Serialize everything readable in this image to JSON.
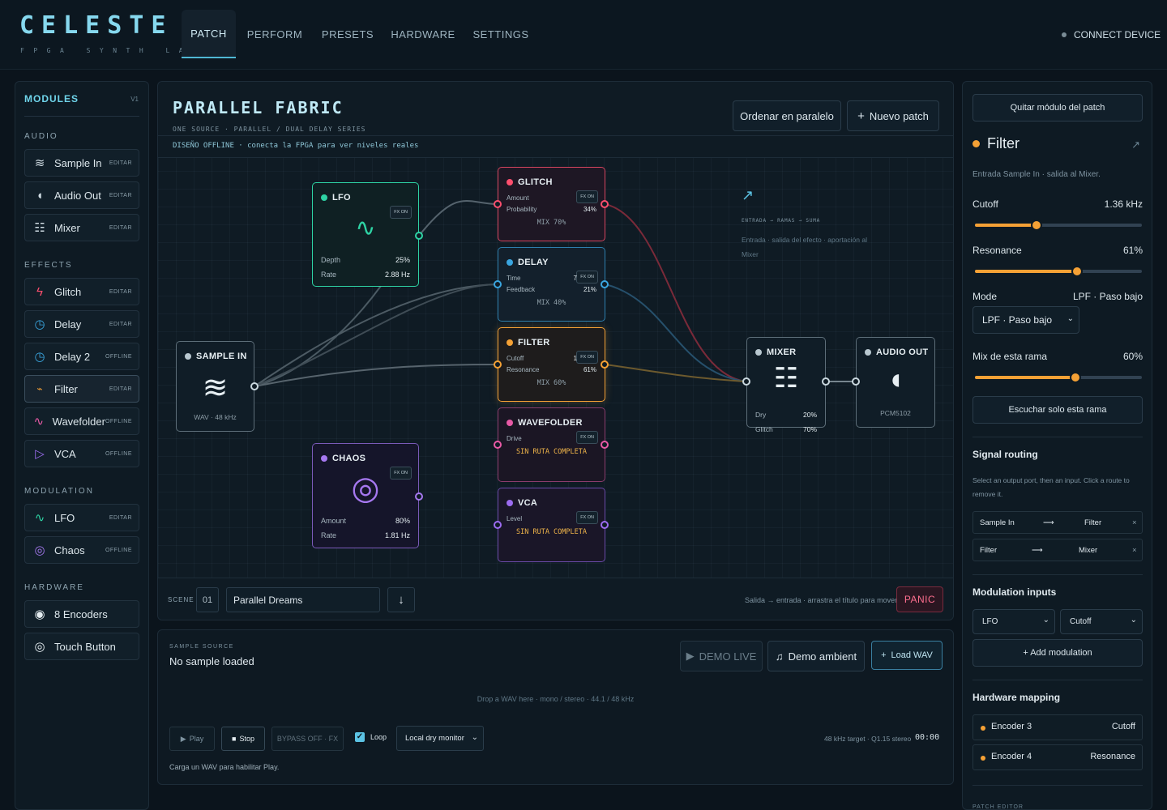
{
  "brand": {
    "title": "CELESTE",
    "subtitle": "FPGA SYNTH LAB"
  },
  "nav": {
    "tabs": [
      "PATCH",
      "PERFORM",
      "PRESETS",
      "HARDWARE",
      "SETTINGS"
    ],
    "active": "PATCH"
  },
  "connect_label": "CONNECT DEVICE",
  "sidebar": {
    "title": "MODULES",
    "version": "V1",
    "sections": [
      {
        "title": "AUDIO",
        "items": [
          {
            "label": "Sample In",
            "badge": "EDITAR",
            "icon": "waves-icon"
          },
          {
            "label": "Audio Out",
            "badge": "EDITAR",
            "icon": "half-moon-icon"
          },
          {
            "label": "Mixer",
            "badge": "EDITAR",
            "icon": "mixer-icon"
          }
        ]
      },
      {
        "title": "EFFECTS",
        "items": [
          {
            "label": "Glitch",
            "badge": "EDITAR",
            "icon": "lightning-icon"
          },
          {
            "label": "Delay",
            "badge": "EDITAR",
            "icon": "clock-icon"
          },
          {
            "label": "Delay 2",
            "badge": "OFFLINE",
            "icon": "clock-icon"
          },
          {
            "label": "Filter",
            "badge": "EDITAR",
            "icon": "filter-icon",
            "active": true
          },
          {
            "label": "Wavefolder",
            "badge": "OFFLINE",
            "icon": "tilde-icon"
          },
          {
            "label": "VCA",
            "badge": "OFFLINE",
            "icon": "triangle-play-icon"
          }
        ]
      },
      {
        "title": "MODULATION",
        "items": [
          {
            "label": "LFO",
            "badge": "EDITAR",
            "icon": "tilde-icon"
          },
          {
            "label": "Chaos",
            "badge": "OFFLINE",
            "icon": "target-icon"
          }
        ]
      },
      {
        "title": "HARDWARE",
        "items": [
          {
            "label": "8 Encoders",
            "badge": "",
            "icon": "knob-icon"
          },
          {
            "label": "Touch Button",
            "badge": "",
            "icon": "touch-icon"
          }
        ]
      }
    ]
  },
  "patch": {
    "title": "PARALLEL FABRIC",
    "subtitle": "ONE SOURCE · PARALLEL / DUAL DELAY SERIES",
    "offline_note": "DISEÑO OFFLINE · conecta la FPGA para ver niveles reales",
    "order_button": "Ordenar en paralelo",
    "new_button": "Nuevo patch",
    "hint_flow": "ENTRADA → RAMAS → SUMA",
    "hint_text_1": "Entrada · salida del efecto · aportación al",
    "hint_text_2": "Mixer"
  },
  "nodes": {
    "lfo": {
      "title": "LFO",
      "badge": "FX ON",
      "color": "#2ed3a4",
      "rows": [
        [
          "Depth",
          "25%"
        ],
        [
          "Rate",
          "2.88 Hz"
        ]
      ]
    },
    "chaos": {
      "title": "CHAOS",
      "badge": "FX ON",
      "color": "#a678f0",
      "rows": [
        [
          "Amount",
          "80%"
        ],
        [
          "Rate",
          "1.81 Hz"
        ]
      ]
    },
    "sample_in": {
      "title": "SAMPLE IN",
      "footer": "WAV · 48 kHz"
    },
    "glitch": {
      "title": "GLITCH",
      "badge": "FX ON",
      "color": "#ff4f6e",
      "rows": [
        [
          "Amount",
          ""
        ],
        [
          "Probability",
          "34%"
        ]
      ],
      "mix": "MIX 70%"
    },
    "delay": {
      "title": "DELAY",
      "badge": "FX ON",
      "color": "#3aa6e0",
      "rows": [
        [
          "Time",
          "7"
        ],
        [
          "Feedback",
          "21%"
        ]
      ],
      "mix": "MIX 40%"
    },
    "filter": {
      "title": "FILTER",
      "badge": "FX ON",
      "color": "#f5a135",
      "rows": [
        [
          "Cutoff",
          "1"
        ],
        [
          "Resonance",
          "61%"
        ]
      ],
      "mix": "MIX 60%"
    },
    "wavefolder": {
      "title": "WAVEFOLDER",
      "badge": "FX ON",
      "color": "#e85aa6",
      "rows": [
        [
          "Drive",
          ""
        ]
      ],
      "warn": "SIN RUTA COMPLETA"
    },
    "vca": {
      "title": "VCA",
      "badge": "FX ON",
      "color": "#9c6cf0",
      "rows": [
        [
          "Level",
          ""
        ]
      ],
      "warn": "SIN RUTA COMPLETA"
    },
    "mixer": {
      "title": "MIXER",
      "rows": [
        [
          "Dry",
          "20%"
        ],
        [
          "Glitch",
          "70%"
        ]
      ]
    },
    "audio_out": {
      "title": "AUDIO OUT",
      "footer": "PCM5102"
    }
  },
  "scene": {
    "label": "SCENE",
    "number": "01",
    "name": "Parallel Dreams",
    "hint": "Salida → entrada · arrastra el título para mover",
    "panic": "PANIC"
  },
  "sample_source": {
    "label": "SAMPLE SOURCE",
    "value": "No sample loaded",
    "demo_live": "DEMO LIVE",
    "demo_ambient": "Demo ambient",
    "load_wav": "Load WAV",
    "drop_hint": "Drop a WAV here · mono / stereo · 44.1 / 48 kHz",
    "play": "Play",
    "stop": "Stop",
    "bypass": "BYPASS OFF · FX",
    "loop": "Loop",
    "loop_checked": true,
    "monitor": "Local dry monitor",
    "rate_info": "48 kHz target · Q1.15 stereo",
    "time": "00:00",
    "footer": "Carga un WAV para habilitar Play."
  },
  "inspector": {
    "remove_button": "Quitar módulo del patch",
    "module_title": "Filter",
    "accent": "#f5a135",
    "description": "Entrada Sample In · salida al Mixer.",
    "cutoff": {
      "label": "Cutoff",
      "value": "1.36 kHz",
      "level": 0.37
    },
    "resonance": {
      "label": "Resonance",
      "value": "61%",
      "level": 0.61
    },
    "mode": {
      "label": "Mode",
      "value": "LPF · Paso bajo",
      "selected": "LPF · Paso bajo"
    },
    "branch_mix": {
      "label": "Mix de esta rama",
      "value": "60%",
      "level": 0.6
    },
    "solo_button": "Escuchar solo esta rama",
    "routing": {
      "title": "Signal routing",
      "help": "Select an output port, then an input. Click a route to remove it.",
      "routes": [
        {
          "from": "Sample In",
          "to": "Filter"
        },
        {
          "from": "Filter",
          "to": "Mixer"
        }
      ]
    },
    "modulation": {
      "title": "Modulation inputs",
      "source": "LFO",
      "target": "Cutoff",
      "add_button": "+ Add modulation"
    },
    "hardware": {
      "title": "Hardware mapping",
      "rows": [
        {
          "control": "Encoder 3",
          "param": "Cutoff"
        },
        {
          "control": "Encoder 4",
          "param": "Resonance"
        }
      ]
    },
    "footer_label": "PATCH EDITOR"
  }
}
